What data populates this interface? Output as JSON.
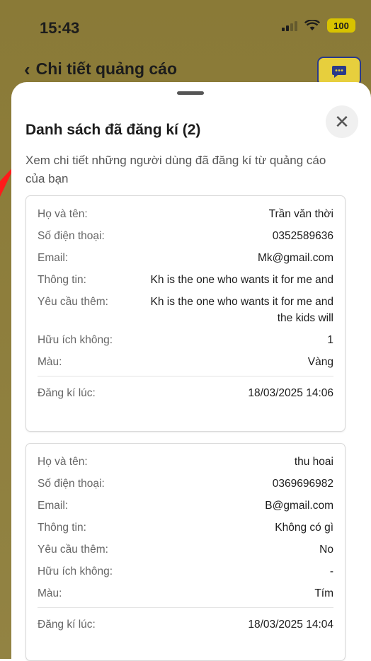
{
  "status_bar": {
    "time": "15:43",
    "battery": "100"
  },
  "app_header": {
    "title": "Chi tiết quảng cáo"
  },
  "sheet": {
    "title": "Danh sách đã đăng kí (2)",
    "description": "Xem chi tiết những người dùng đã đăng kí từ quảng cáo của bạn",
    "labels": {
      "name": "Họ và tên:",
      "phone": "Số điện thoại:",
      "email": "Email:",
      "info": "Thông tin:",
      "request": "Yêu cầu  thêm:",
      "useful": "Hữu ích không:",
      "color": "Màu:",
      "registered_at": "Đăng kí lúc:"
    },
    "registrations": [
      {
        "name": "Trần văn thời",
        "phone": "0352589636",
        "email": "Mk@gmail.com",
        "info": "Kh is the one who wants it for me and",
        "request": "Kh is the one who wants it for me and the kids will",
        "useful": "1",
        "color": "Vàng",
        "registered_at": "18/03/2025 14:06"
      },
      {
        "name": "thu hoai",
        "phone": "0369696982",
        "email": "B@gmail.com",
        "info": "Không có gì",
        "request": "No",
        "useful": "-",
        "color": "Tím",
        "registered_at": "18/03/2025 14:04"
      }
    ]
  },
  "colors": {
    "background_dim": "#8a7a37",
    "accent_yellow": "#e7cf3d",
    "annotation_red": "#ff1a1a"
  }
}
